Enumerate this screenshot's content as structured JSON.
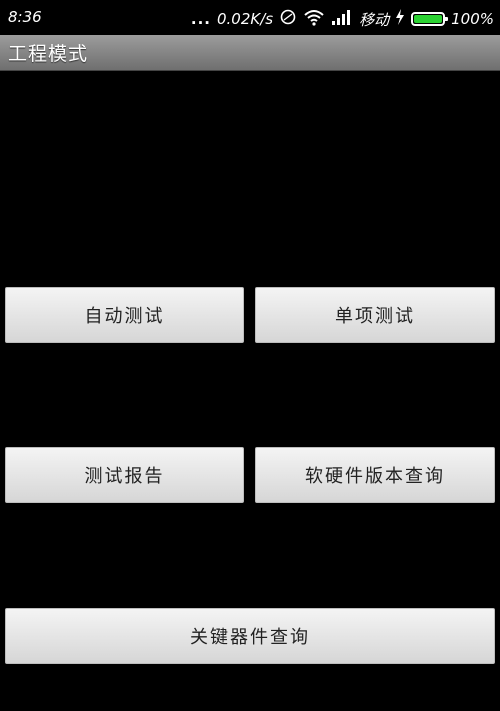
{
  "status_bar": {
    "time": "8:36",
    "dots": "...",
    "speed": "0.02K/s",
    "carrier": "移动",
    "battery_percent": "100%",
    "battery_level": 1.0,
    "battery_color": "#2cd233",
    "icons": [
      "dots-icon",
      "sync-icon",
      "wifi-icon",
      "signal-icon",
      "charging-icon",
      "battery-icon"
    ]
  },
  "title_bar": {
    "title": "工程模式"
  },
  "buttons": {
    "auto_test": "自动测试",
    "single_test": "单项测试",
    "test_report": "测试报告",
    "sw_hw_version": "软硬件版本查询",
    "key_component": "关键器件查询"
  }
}
